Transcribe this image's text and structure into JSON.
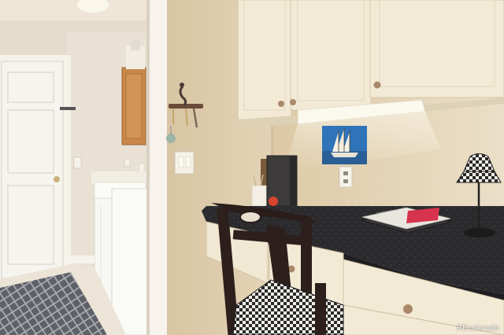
{
  "photo": {
    "subject": "",
    "watermark": "REcolorado"
  },
  "colors": {
    "wall": "#e6d7bd",
    "cabinet": "#f3ead6",
    "countertop": "#2a2a2c",
    "laundry_wall": "#e9e0d2",
    "oak_cabinet": "#c98a4a",
    "floor": "#ece4d6",
    "rug": "#6b6e75"
  },
  "icons": {
    "lamp": "table-lamp-icon",
    "sailboat": "sailboat-painting-icon",
    "hooks": "key-hooks-icon"
  }
}
